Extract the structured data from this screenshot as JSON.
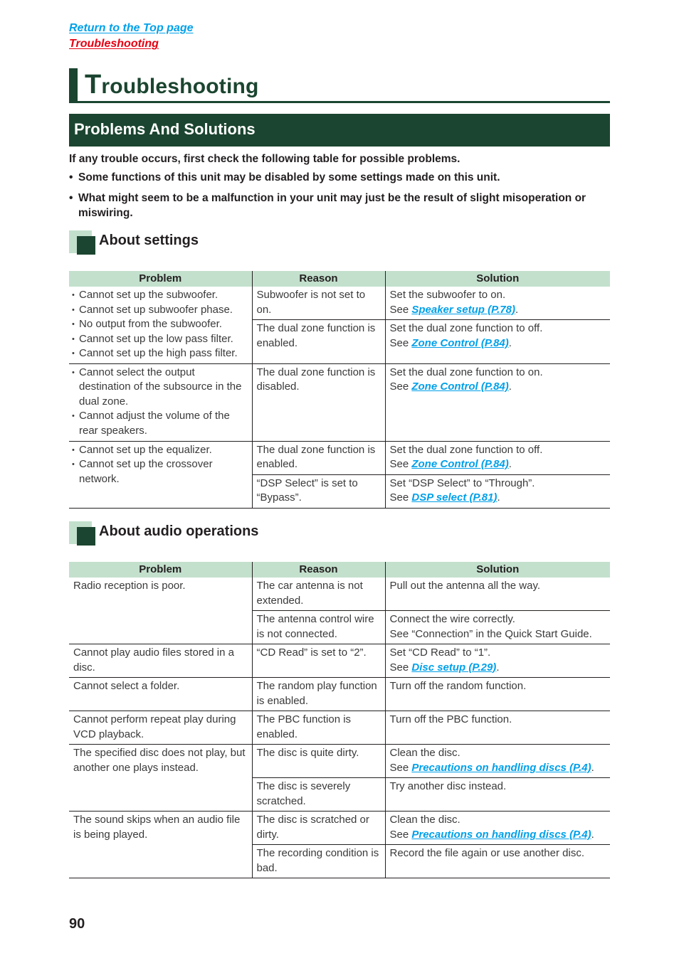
{
  "nav": {
    "top_link": "Return to the Top page",
    "current_link": "Troubleshooting"
  },
  "colors": {
    "brand_green": "#1b4530",
    "light_green": "#c3e0cd",
    "link_blue": "#00a0e9",
    "link_red": "#e60012"
  },
  "page_title": {
    "first_letter": "T",
    "rest": "roubleshooting"
  },
  "section_title": "Problems And Solutions",
  "intro": {
    "lead": "If any trouble occurs, first check the following table for possible problems.",
    "bullets": [
      "Some functions of this unit may be disabled by some settings made on this unit.",
      "What might seem to be a malfunction in your unit may just be the result of slight misoperation or miswiring."
    ]
  },
  "settings": {
    "heading": "About settings",
    "columns": [
      "Problem",
      "Reason",
      "Solution"
    ],
    "groups": [
      {
        "problems": [
          "Cannot set up the subwoofer.",
          "Cannot set up subwoofer phase.",
          "No output from the subwoofer.",
          "Cannot set up the low pass filter.",
          "Cannot set up the high pass filter."
        ],
        "rows": [
          {
            "reason": "Subwoofer is not set to on.",
            "solution": "Set the subwoofer to on.",
            "see": "See ",
            "link": "Speaker setup (P.78)",
            "end": "."
          },
          {
            "reason": "The dual zone function is enabled.",
            "solution": "Set the dual zone function to off.",
            "see": "See ",
            "link": "Zone Control (P.84)",
            "end": "."
          }
        ]
      },
      {
        "problems": [
          "Cannot select the output destination of the subsource in the dual zone.",
          "Cannot adjust the volume of the rear speakers."
        ],
        "rows": [
          {
            "reason": "The dual zone function is disabled.",
            "solution": "Set the dual zone function to on.",
            "see": "See ",
            "link": "Zone Control (P.84)",
            "end": "."
          }
        ]
      },
      {
        "problems": [
          "Cannot set up the equalizer.",
          "Cannot set up the crossover network."
        ],
        "rows": [
          {
            "reason": "The dual zone function is enabled.",
            "solution": "Set the dual zone function to off.",
            "see": "See ",
            "link": "Zone Control (P.84)",
            "end": "."
          },
          {
            "reason": "“DSP Select” is set to “Bypass”.",
            "solution": "Set “DSP Select” to “Through”.",
            "see": "See ",
            "link": "DSP select (P.81)",
            "end": "."
          }
        ]
      }
    ]
  },
  "audio": {
    "heading": "About audio operations",
    "columns": [
      "Problem",
      "Reason",
      "Solution"
    ],
    "groups": [
      {
        "problem": "Radio reception is poor.",
        "rows": [
          {
            "reason": "The car antenna is not extended.",
            "solution": "Pull out the antenna all the way."
          },
          {
            "reason": "The antenna control wire is not connected.",
            "solution": "Connect the wire correctly.",
            "solution2": "See “Connection” in the Quick Start Guide."
          }
        ]
      },
      {
        "problem": "Cannot play audio files stored in a disc.",
        "rows": [
          {
            "reason": "“CD Read” is set to “2”.",
            "solution": "Set “CD Read” to “1”.",
            "see": "See ",
            "link": "Disc setup (P.29)",
            "end": "."
          }
        ]
      },
      {
        "problem": "Cannot select a folder.",
        "rows": [
          {
            "reason": "The random play function is enabled.",
            "solution": "Turn off the random function."
          }
        ]
      },
      {
        "problem": "Cannot perform repeat play during VCD playback.",
        "rows": [
          {
            "reason": "The PBC function is enabled.",
            "solution": "Turn off the PBC function."
          }
        ]
      },
      {
        "problem": "The specified disc does not play, but another one plays instead.",
        "rows": [
          {
            "reason": "The disc is quite dirty.",
            "solution": "Clean the disc.",
            "see": "See ",
            "link": "Precautions on handling discs (P.4)",
            "end": "."
          },
          {
            "reason": "The disc is severely scratched.",
            "solution": "Try another disc instead."
          }
        ]
      },
      {
        "problem": "The sound skips when an audio file is being played.",
        "rows": [
          {
            "reason": "The disc is scratched or dirty.",
            "solution": "Clean the disc.",
            "see": "See ",
            "link": "Precautions on handling discs (P.4)",
            "end": "."
          },
          {
            "reason": "The recording condition is bad.",
            "solution": "Record the file again or use another disc."
          }
        ]
      }
    ]
  },
  "page_number": "90"
}
